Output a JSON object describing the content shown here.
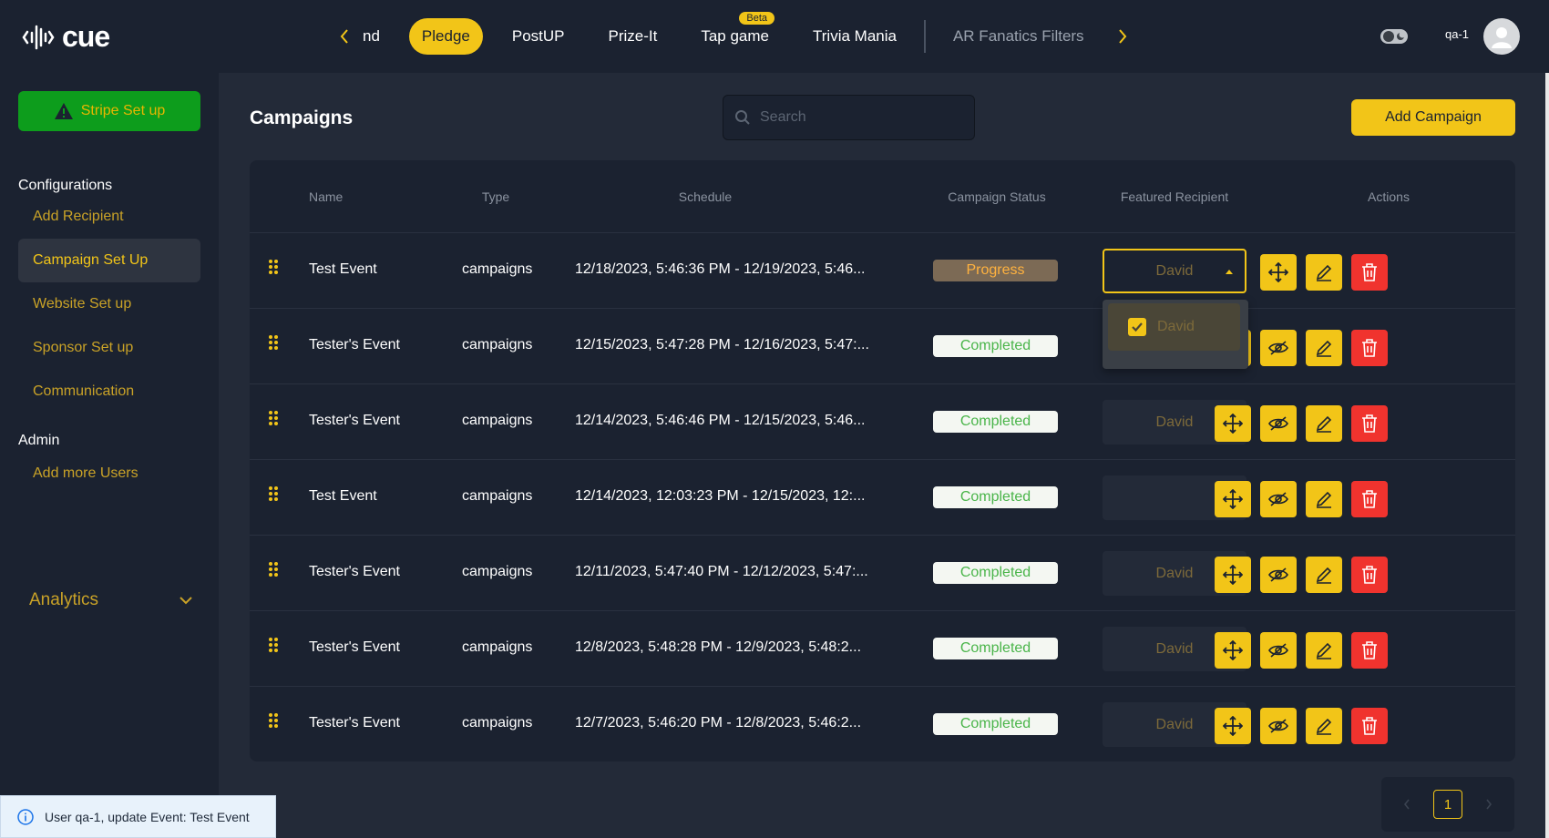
{
  "header": {
    "logo_text": "cue",
    "tabs": [
      {
        "label": "nd"
      },
      {
        "label": "Pledge"
      },
      {
        "label": "PostUP"
      },
      {
        "label": "Prize-It"
      },
      {
        "label": "Tap game",
        "badge": "Beta"
      },
      {
        "label": "Trivia Mania"
      },
      {
        "label": "AR Fanatics Filters"
      }
    ],
    "active_tab": "Pledge",
    "user_name": "qa-1"
  },
  "sidebar": {
    "stripe_button": "Stripe Set up",
    "configurations_title": "Configurations",
    "config_items": [
      {
        "label": "Add Recipient"
      },
      {
        "label": "Campaign Set Up"
      },
      {
        "label": "Website Set up"
      },
      {
        "label": "Sponsor Set up"
      },
      {
        "label": "Communication"
      }
    ],
    "active_item": "Campaign Set Up",
    "admin_title": "Admin",
    "admin_items": [
      {
        "label": "Add more Users"
      }
    ],
    "analytics_label": "Analytics"
  },
  "main": {
    "title": "Campaigns",
    "search_placeholder": "Search",
    "add_button": "Add Campaign",
    "columns": {
      "name": "Name",
      "type": "Type",
      "schedule": "Schedule",
      "status": "Campaign Status",
      "recipient": "Featured Recipient",
      "actions": "Actions"
    },
    "rows": [
      {
        "name": "Test Event",
        "type": "campaigns",
        "schedule": "12/18/2023, 5:46:36 PM - 12/19/2023, 5:46...",
        "status": "Progress",
        "recipient": "David"
      },
      {
        "name": "Tester's Event",
        "type": "campaigns",
        "schedule": "12/15/2023, 5:47:28 PM - 12/16/2023, 5:47:...",
        "status": "Completed",
        "recipient": ""
      },
      {
        "name": "Tester's Event",
        "type": "campaigns",
        "schedule": "12/14/2023, 5:46:46 PM - 12/15/2023, 5:46...",
        "status": "Completed",
        "recipient": "David"
      },
      {
        "name": "Test Event",
        "type": "campaigns",
        "schedule": "12/14/2023, 12:03:23 PM - 12/15/2023, 12:...",
        "status": "Completed",
        "recipient": ""
      },
      {
        "name": "Tester's Event",
        "type": "campaigns",
        "schedule": "12/11/2023, 5:47:40 PM - 12/12/2023, 5:47:...",
        "status": "Completed",
        "recipient": "David"
      },
      {
        "name": "Tester's Event",
        "type": "campaigns",
        "schedule": "12/8/2023, 5:48:28 PM - 12/9/2023, 5:48:2...",
        "status": "Completed",
        "recipient": "David"
      },
      {
        "name": "Tester's Event",
        "type": "campaigns",
        "schedule": "12/7/2023, 5:46:20 PM - 12/8/2023, 5:46:2...",
        "status": "Completed",
        "recipient": "David"
      }
    ],
    "dropdown_option": "David"
  },
  "toast": {
    "message": "User qa-1, update Event: Test Event"
  },
  "pagination": {
    "current_page": "1"
  },
  "colors": {
    "accent": "#f2c518",
    "danger": "#f0332e",
    "success": "#0d9d1c",
    "background": "#1b2230"
  }
}
